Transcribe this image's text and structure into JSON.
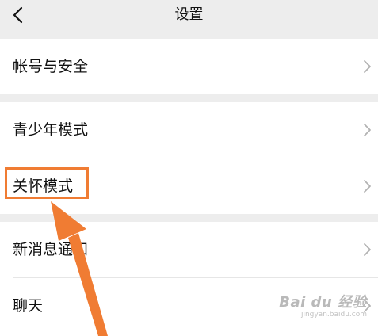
{
  "header": {
    "back_icon": "chevron-left-icon",
    "title": "设置"
  },
  "groups": [
    {
      "items": [
        {
          "label": "帐号与安全",
          "icon": "chevron-right-icon"
        }
      ]
    },
    {
      "items": [
        {
          "label": "青少年模式",
          "icon": "chevron-right-icon"
        },
        {
          "label": "关怀模式",
          "icon": "chevron-right-icon",
          "highlighted": true
        }
      ]
    },
    {
      "items": [
        {
          "label": "新消息通知",
          "icon": "chevron-right-icon"
        },
        {
          "label": "聊天",
          "icon": "chevron-right-icon"
        }
      ]
    }
  ],
  "annotation": {
    "highlight_color": "#f07c33",
    "arrow_color": "#f07c33"
  },
  "watermark": {
    "brand": "Bai du 经验",
    "url": "jingyan.baidu.com"
  },
  "colors": {
    "background": "#ededed",
    "card": "#ffffff",
    "text": "#111111",
    "chevron": "#b2b2b2",
    "accent": "#f07c33"
  }
}
